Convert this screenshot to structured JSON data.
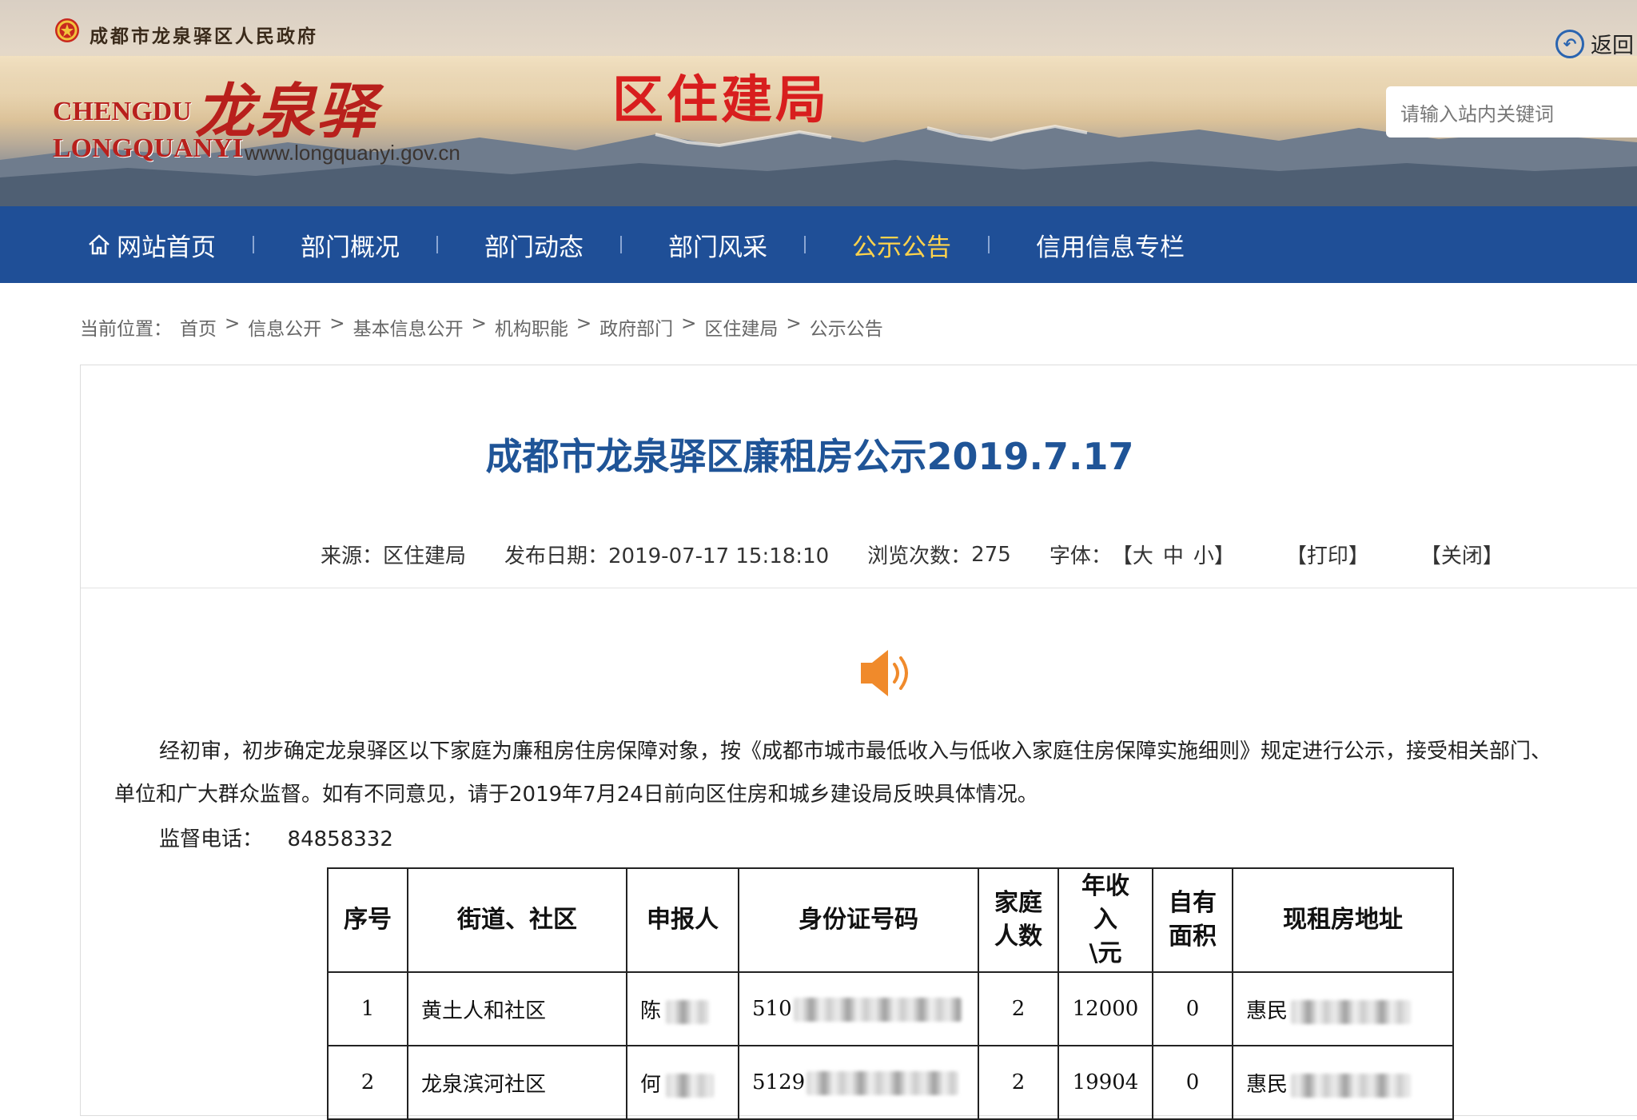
{
  "header": {
    "gov_name": "成都市龙泉驿区人民政府",
    "logo_cn": "龙泉驿",
    "logo_en_line1": "CHENGDU",
    "logo_en_line2": "LONGQUANYI",
    "logo_url": "www.longquanyi.gov.cn",
    "dept_title": "区住建局",
    "back_label": "返回",
    "search_placeholder": "请输入站内关键词"
  },
  "nav": {
    "items": [
      {
        "label": "网站首页",
        "icon": "home-icon"
      },
      {
        "label": "部门概况"
      },
      {
        "label": "部门动态"
      },
      {
        "label": "部门风采"
      },
      {
        "label": "公示公告",
        "active": true
      },
      {
        "label": "信用信息专栏"
      }
    ]
  },
  "breadcrumb": {
    "prefix": "当前位置：",
    "items": [
      "首页",
      "信息公开",
      "基本信息公开",
      "机构职能",
      "政府部门",
      "区住建局",
      "公示公告"
    ],
    "separator": ">"
  },
  "article": {
    "title": "成都市龙泉驿区廉租房公示2019.7.17",
    "meta": {
      "source": "来源：区住建局",
      "date": "发布日期：2019-07-17 15:18:10",
      "views_label": "浏览次数：",
      "views": "275",
      "font_label": "字体：",
      "font_open": "【",
      "font_large": "大",
      "font_medium": "中",
      "font_small": "小",
      "font_close": "】",
      "print": "【打印】",
      "close": "【关闭】"
    },
    "speaker_icon": "speaker-icon",
    "paragraph_line1": "经初审，初步确定龙泉驿区以下家庭为廉租房住房保障对象，按《成都市城市最低收入与低收入家庭住房保障实施细则》规定进行公示，接受相关部门、",
    "paragraph_line2": "单位和广大群众监督。如有不同意见，请于2019年7月24日前向区住房和城乡建设局反映具体情况。",
    "phone_label": "监督电话：",
    "phone": "84858332"
  },
  "table": {
    "headers": [
      "序号",
      "街道、社区",
      "申报人",
      "身份证号码",
      "家庭人数",
      "年收入\\元",
      "自有面积",
      "现租房地址"
    ],
    "header_display": {
      "h5_line1": "家庭",
      "h5_line2": "人数",
      "h6_line1": "年收",
      "h6_line2": "入",
      "h6_line3": "\\元",
      "h7_line1": "自有",
      "h7_line2": "面积"
    },
    "rows": [
      {
        "no": "1",
        "community": "黄土人和社区",
        "applicant": "陈",
        "id": "510",
        "family": "2",
        "income": "12000",
        "area": "0",
        "address": "惠民"
      },
      {
        "no": "2",
        "community": "龙泉滨河社区",
        "applicant": "何",
        "id": "5129",
        "family": "2",
        "income": "19904",
        "area": "0",
        "address": "惠民"
      }
    ]
  }
}
